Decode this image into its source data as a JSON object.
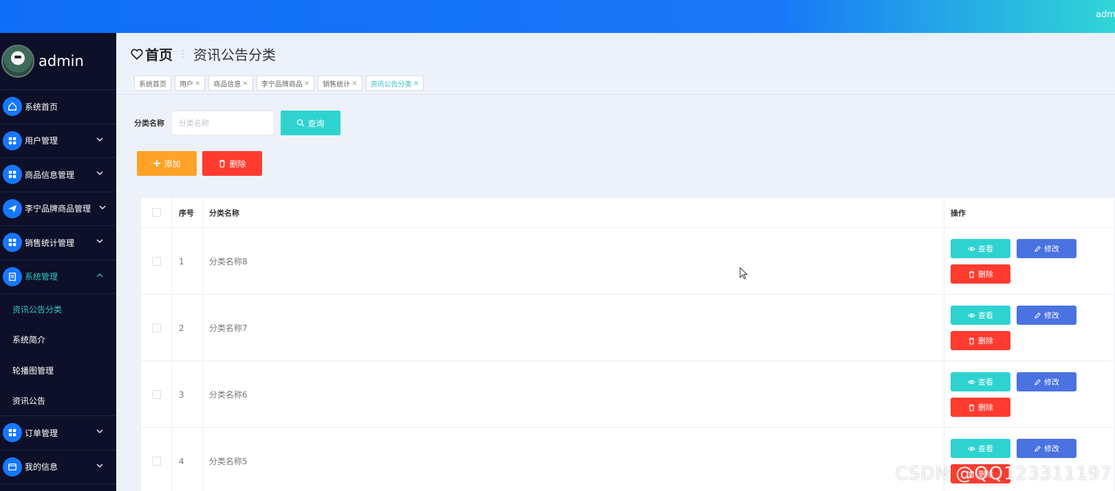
{
  "topbar": {
    "user": "admin"
  },
  "sidebar": {
    "profile_name": "admin",
    "items": [
      {
        "label": "系统首页",
        "icon": "home-icon"
      },
      {
        "label": "用户管理",
        "icon": "grid-icon"
      },
      {
        "label": "商品信息管理",
        "icon": "grid-icon"
      },
      {
        "label": "李宁品牌商品管理",
        "icon": "paper-plane-icon"
      },
      {
        "label": "销售统计管理",
        "icon": "grid-icon"
      },
      {
        "label": "系统管理",
        "icon": "document-icon"
      },
      {
        "label": "订单管理",
        "icon": "grid-icon"
      },
      {
        "label": "我的信息",
        "icon": "wallet-icon"
      }
    ],
    "sub_items": [
      "资讯公告分类",
      "系统简介",
      "轮播图管理",
      "资讯公告"
    ]
  },
  "breadcrumb": {
    "home": "首页",
    "current": "资讯公告分类"
  },
  "tabs": [
    "系统首页",
    "用户",
    "商品信息",
    "李宁品牌商品",
    "销售统计",
    "资讯公告分类"
  ],
  "search": {
    "label": "分类名称",
    "placeholder": "分类名称",
    "value": "",
    "button": "查询"
  },
  "actions": {
    "add": "添加",
    "delete": "删除"
  },
  "table": {
    "headers": [
      "序号",
      "分类名称",
      "操作"
    ],
    "rows": [
      {
        "index": "1",
        "name": "分类名称8"
      },
      {
        "index": "2",
        "name": "分类名称7"
      },
      {
        "index": "3",
        "name": "分类名称6"
      },
      {
        "index": "4",
        "name": "分类名称5"
      }
    ],
    "row_actions": {
      "view": "查看",
      "edit": "修改",
      "delete": "删除"
    }
  },
  "watermark": "CSDN @QQ123311197",
  "colors": {
    "accent": "#2ed3d0",
    "primary": "#1677ff",
    "danger": "#ff3b2f",
    "warning": "#ffa227",
    "edit": "#4a72e0",
    "sidebar_bg": "#0d1028"
  }
}
